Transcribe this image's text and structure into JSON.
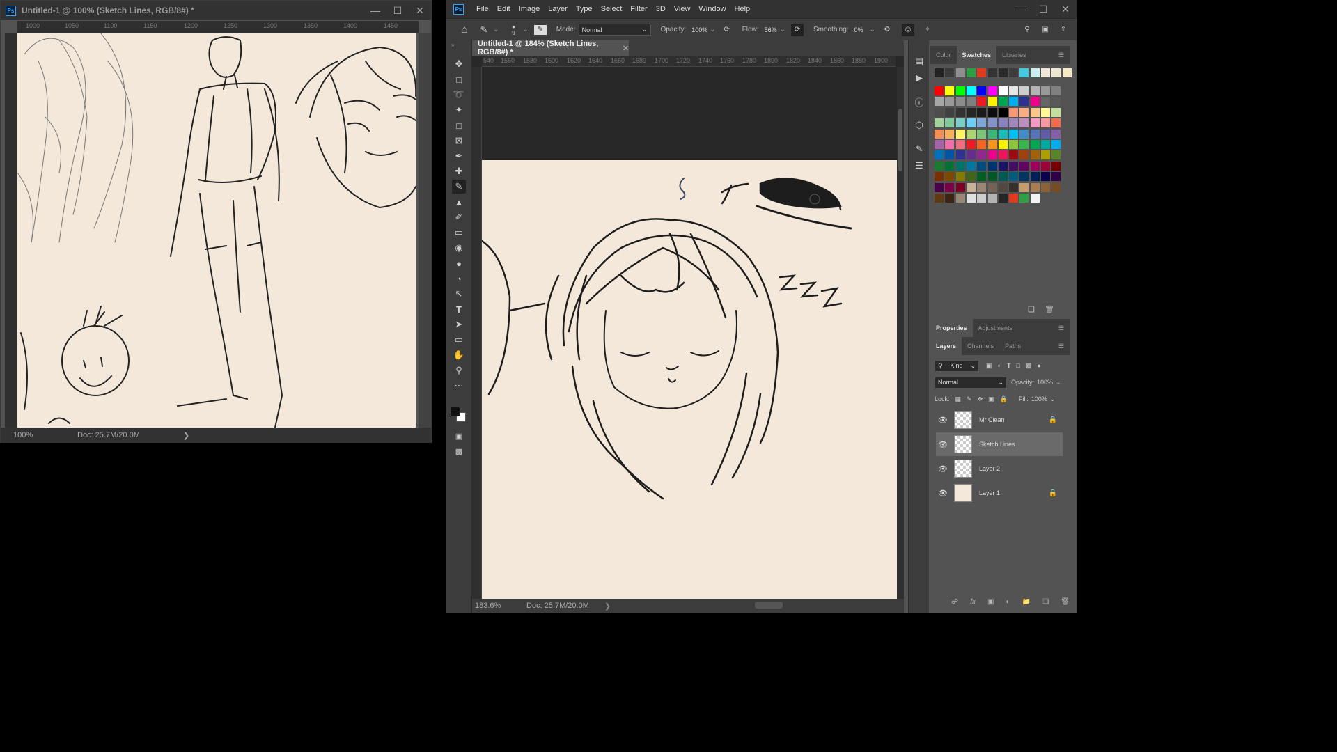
{
  "window1": {
    "title": "Untitled-1 @ 100% (Sketch Lines, RGB/8#) *",
    "ruler_ticks": [
      "1000",
      "1050",
      "1100",
      "1150",
      "1200",
      "1250",
      "1300",
      "1350",
      "1400",
      "1450"
    ],
    "zoom": "100%",
    "doc_info": "Doc: 25.7M/20.0M"
  },
  "window2": {
    "menu": [
      "File",
      "Edit",
      "Image",
      "Layer",
      "Type",
      "Select",
      "Filter",
      "3D",
      "View",
      "Window",
      "Help"
    ],
    "options": {
      "brush_size": "9",
      "mode_label": "Mode:",
      "mode_value": "Normal",
      "opacity_label": "Opacity:",
      "opacity_value": "100%",
      "flow_label": "Flow:",
      "flow_value": "56%",
      "smoothing_label": "Smoothing:",
      "smoothing_value": "0%"
    },
    "doc_tab": "Untitled-1 @ 184% (Sketch Lines, RGB/8#) *",
    "ruler_ticks": [
      "540",
      "1560",
      "1580",
      "1600",
      "1620",
      "1640",
      "1660",
      "1680",
      "1700",
      "1720",
      "1740",
      "1760",
      "1780",
      "1800",
      "1820",
      "1840",
      "1860",
      "1880",
      "1900"
    ],
    "zoom": "183.6%",
    "doc_info": "Doc: 25.7M/20.0M",
    "canvas_text": "zzz"
  },
  "swatch_panel": {
    "tabs": [
      "Color",
      "Swatches",
      "Libraries"
    ],
    "active_tab": "Swatches",
    "recent": [
      "#222222",
      "#3a3a3a",
      "#8f8f8f",
      "#2ea043",
      "#e03a1f",
      "#333333",
      "#2a2a2a",
      "#3d3d3d",
      "#44c8e0",
      "#c8eef0",
      "#f2e7d6",
      "#efe6d0",
      "#f7e8c8"
    ],
    "rows": [
      [
        "#ff0000",
        "#ffff00",
        "#00ff00",
        "#00ffff",
        "#0000ff",
        "#ff00ff",
        "#ffffff",
        "#e6e6e6",
        "#cccccc",
        "#b3b3b3",
        "#999999",
        "#808080"
      ],
      [
        "#a6a6a6",
        "#999999",
        "#8c8c8c",
        "#7f7f7f",
        "#ed1c24",
        "#fff200",
        "#00a651",
        "#00aeef",
        "#2e3192",
        "#ec008c",
        "#666666",
        "#595959"
      ],
      [
        "#4d4d4d",
        "#404040",
        "#333333",
        "#262626",
        "#1a1a1a",
        "#0d0d0d",
        "#000000",
        "#f7977a",
        "#f9ad81",
        "#fdc68a",
        "#fff79a",
        "#c4df9b"
      ],
      [
        "#a3d39c",
        "#82ca9d",
        "#7bcdc8",
        "#6ecff6",
        "#7ea7d8",
        "#8493ca",
        "#8882be",
        "#a187be",
        "#bc8dbf",
        "#f49ac2",
        "#f6989d",
        "#f26c4f"
      ],
      [
        "#f68e55",
        "#fbaf5c",
        "#fff467",
        "#acd372",
        "#7cc576",
        "#3bb878",
        "#1abbb4",
        "#00bff3",
        "#438ccb",
        "#5574b9",
        "#605ca8",
        "#855fa8"
      ],
      [
        "#a763a8",
        "#f06ea9",
        "#f26d7d",
        "#ed1c24",
        "#f26522",
        "#f7941d",
        "#fff200",
        "#8dc63f",
        "#39b54a",
        "#00a651",
        "#00a99d",
        "#00aeef"
      ],
      [
        "#0072bc",
        "#0054a6",
        "#2e3192",
        "#662d91",
        "#92278f",
        "#ec008c",
        "#ed145b",
        "#9e0b0f",
        "#a0410d",
        "#a36209",
        "#aba000",
        "#598527"
      ],
      [
        "#1a7b30",
        "#007236",
        "#00746b",
        "#0076a3",
        "#004b80",
        "#003471",
        "#1b1464",
        "#440e62",
        "#630460",
        "#9e005d",
        "#9e0039",
        "#790000"
      ],
      [
        "#7b2e00",
        "#7d4900",
        "#827b00",
        "#406618",
        "#005e20",
        "#005826",
        "#005952",
        "#005b7f",
        "#003663",
        "#002157",
        "#0d004c",
        "#32004b"
      ],
      [
        "#4b0049",
        "#7b0046",
        "#7a0026",
        "#c7b299",
        "#998675",
        "#736357",
        "#534741",
        "#37302d",
        "#c69c6d",
        "#a67c52",
        "#8c6239",
        "#754c24"
      ],
      [
        "#603913",
        "#3c2415",
        "#998675",
        "#e0e0e0",
        "#cccccc",
        "#b3b3b3",
        "#262626",
        "#e03a1f",
        "#2ea043",
        "#f2f2f2"
      ]
    ]
  },
  "properties_tabs": [
    "Properties",
    "Adjustments"
  ],
  "layers_panel": {
    "tabs": [
      "Layers",
      "Channels",
      "Paths"
    ],
    "kind_label": "Kind",
    "blend_mode": "Normal",
    "opacity_label": "Opacity:",
    "opacity_value": "100%",
    "lock_label": "Lock:",
    "fill_label": "Fill:",
    "fill_value": "100%",
    "layers": [
      {
        "name": "Mr Clean",
        "locked": true,
        "selected": false
      },
      {
        "name": "Sketch Lines",
        "locked": false,
        "selected": true
      },
      {
        "name": "Layer 2",
        "locked": false,
        "selected": false
      },
      {
        "name": "Layer 1",
        "locked": true,
        "selected": false
      }
    ]
  }
}
